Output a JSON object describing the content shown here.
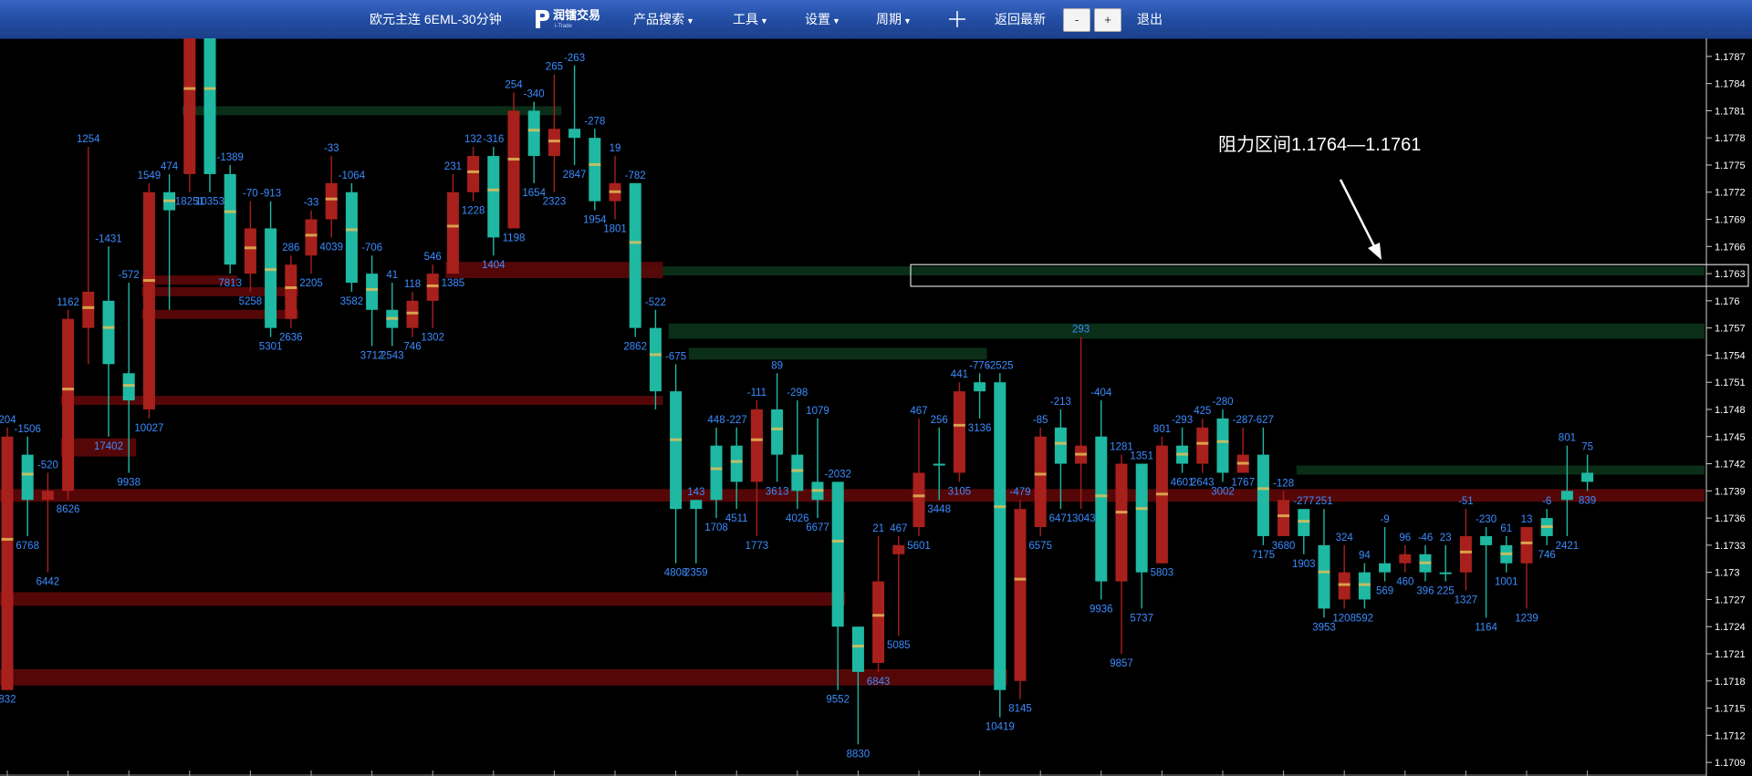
{
  "toolbar": {
    "title": "欧元主连 6EML-30分钟",
    "logo_text": "润镭交易",
    "logo_sub": "i-Trade",
    "product_search": "产品搜索",
    "tools": "工具",
    "settings": "设置",
    "period": "周期",
    "back_latest": "返回最新",
    "minus": "-",
    "plus": "+",
    "exit": "退出"
  },
  "annotation": {
    "text": "阻力区间1.1764—1.1761"
  },
  "colors": {
    "up": "#1fb8a2",
    "down": "#a8201c",
    "label": "#3b8cff",
    "axis_text": "#ffffff"
  },
  "chart_data": {
    "type": "candlestick",
    "interval": "30分钟",
    "ylim": [
      1.17075,
      1.1789
    ],
    "y_ticks": [
      "1.1787",
      "1.1784",
      "1.1781",
      "1.1778",
      "1.1775",
      "1.1772",
      "1.1769",
      "1.1766",
      "1.1763",
      "1.176",
      "1.1757",
      "1.1754",
      "1.1751",
      "1.1748",
      "1.1745",
      "1.1742",
      "1.1739",
      "1.1736",
      "1.1733",
      "1.173",
      "1.1727",
      "1.1724",
      "1.1721",
      "1.1718",
      "1.1715",
      "1.1712",
      "1.1709"
    ],
    "candles": [
      {
        "o": 1.1745,
        "h": 1.1746,
        "l": 1.1717,
        "c": 1.1717,
        "top": "204",
        "bot": "832"
      },
      {
        "o": 1.1738,
        "h": 1.1745,
        "l": 1.1734,
        "c": 1.1743,
        "top": "-1506",
        "bot": "6768"
      },
      {
        "o": 1.1739,
        "h": 1.1741,
        "l": 1.173,
        "c": 1.1738,
        "top": "-520",
        "bot": "6442"
      },
      {
        "o": 1.1758,
        "h": 1.1759,
        "l": 1.1738,
        "c": 1.1739,
        "top": "1162",
        "bot": "8626"
      },
      {
        "o": 1.1761,
        "h": 1.1777,
        "l": 1.1753,
        "c": 1.1757,
        "top": "1254",
        "bot": ""
      },
      {
        "o": 1.1753,
        "h": 1.1766,
        "l": 1.1745,
        "c": 1.176,
        "top": "-1431",
        "bot": "17402"
      },
      {
        "o": 1.1749,
        "h": 1.1762,
        "l": 1.1741,
        "c": 1.1752,
        "top": "-572",
        "bot": "9938"
      },
      {
        "o": 1.1772,
        "h": 1.1773,
        "l": 1.1747,
        "c": 1.1748,
        "top": "1549",
        "bot": "10027"
      },
      {
        "o": 1.177,
        "h": 1.1774,
        "l": 1.1759,
        "c": 1.1772,
        "top": "474",
        "bot": ""
      },
      {
        "o": 1.179,
        "h": 1.1792,
        "l": 1.1772,
        "c": 1.1774,
        "top": "",
        "bot": "18251"
      },
      {
        "o": 1.1774,
        "h": 1.1792,
        "l": 1.1772,
        "c": 1.179,
        "top": "",
        "bot": "10353"
      },
      {
        "o": 1.1764,
        "h": 1.1775,
        "l": 1.1763,
        "c": 1.1774,
        "top": "-1389",
        "bot": "7813"
      },
      {
        "o": 1.1768,
        "h": 1.1771,
        "l": 1.1761,
        "c": 1.1763,
        "top": "-70",
        "bot": "5258"
      },
      {
        "o": 1.1757,
        "h": 1.1771,
        "l": 1.1756,
        "c": 1.1768,
        "top": "-913",
        "bot": "5301"
      },
      {
        "o": 1.1764,
        "h": 1.1765,
        "l": 1.1757,
        "c": 1.1758,
        "top": "286",
        "bot": "2636"
      },
      {
        "o": 1.1769,
        "h": 1.177,
        "l": 1.1763,
        "c": 1.1765,
        "top": "-33",
        "bot": "2205"
      },
      {
        "o": 1.1773,
        "h": 1.1776,
        "l": 1.1767,
        "c": 1.1769,
        "top": "-33",
        "bot": "4039"
      },
      {
        "o": 1.1762,
        "h": 1.1773,
        "l": 1.1761,
        "c": 1.1772,
        "top": "-1064",
        "bot": "3582"
      },
      {
        "o": 1.1759,
        "h": 1.1765,
        "l": 1.1755,
        "c": 1.1763,
        "top": "-706",
        "bot": "3712"
      },
      {
        "o": 1.1757,
        "h": 1.1762,
        "l": 1.1755,
        "c": 1.1759,
        "top": "41",
        "bot": "2543"
      },
      {
        "o": 1.176,
        "h": 1.1761,
        "l": 1.1756,
        "c": 1.1757,
        "top": "118",
        "bot": "746"
      },
      {
        "o": 1.1763,
        "h": 1.1764,
        "l": 1.1757,
        "c": 1.176,
        "top": "546",
        "bot": "1302"
      },
      {
        "o": 1.1772,
        "h": 1.1774,
        "l": 1.1763,
        "c": 1.1763,
        "top": "231",
        "bot": "1385"
      },
      {
        "o": 1.1776,
        "h": 1.1777,
        "l": 1.1771,
        "c": 1.1772,
        "top": "132",
        "bot": "1228"
      },
      {
        "o": 1.1767,
        "h": 1.1777,
        "l": 1.1765,
        "c": 1.1776,
        "top": "-316",
        "bot": "1404"
      },
      {
        "o": 1.1781,
        "h": 1.1783,
        "l": 1.1768,
        "c": 1.1768,
        "top": "254",
        "bot": "1198"
      },
      {
        "o": 1.1776,
        "h": 1.1782,
        "l": 1.1773,
        "c": 1.1781,
        "top": "-340",
        "bot": "1654"
      },
      {
        "o": 1.1779,
        "h": 1.1785,
        "l": 1.1772,
        "c": 1.1776,
        "top": "265",
        "bot": "2323"
      },
      {
        "o": 1.1778,
        "h": 1.1786,
        "l": 1.1775,
        "c": 1.1779,
        "top": "-263",
        "bot": "2847"
      },
      {
        "o": 1.1771,
        "h": 1.1779,
        "l": 1.177,
        "c": 1.1778,
        "top": "-278",
        "bot": "1954"
      },
      {
        "o": 1.1773,
        "h": 1.1776,
        "l": 1.1769,
        "c": 1.1771,
        "top": "19",
        "bot": "1801"
      },
      {
        "o": 1.1757,
        "h": 1.1773,
        "l": 1.1756,
        "c": 1.1773,
        "top": "-782",
        "bot": "2862"
      },
      {
        "o": 1.175,
        "h": 1.1759,
        "l": 1.1748,
        "c": 1.1757,
        "top": "-522",
        "bot": ""
      },
      {
        "o": 1.1737,
        "h": 1.1753,
        "l": 1.1731,
        "c": 1.175,
        "top": "-675",
        "bot": "4808"
      },
      {
        "o": 1.1737,
        "h": 1.1738,
        "l": 1.1731,
        "c": 1.1738,
        "top": "143",
        "bot": "2359"
      },
      {
        "o": 1.1738,
        "h": 1.1746,
        "l": 1.1736,
        "c": 1.1744,
        "top": "448",
        "bot": "1708"
      },
      {
        "o": 1.174,
        "h": 1.1746,
        "l": 1.1737,
        "c": 1.1744,
        "top": "-227",
        "bot": "4511"
      },
      {
        "o": 1.1748,
        "h": 1.1749,
        "l": 1.1734,
        "c": 1.174,
        "top": "-111",
        "bot": "1773"
      },
      {
        "o": 1.1743,
        "h": 1.1752,
        "l": 1.174,
        "c": 1.1748,
        "top": "89",
        "bot": "3613"
      },
      {
        "o": 1.1739,
        "h": 1.1749,
        "l": 1.1737,
        "c": 1.1743,
        "top": "-298",
        "bot": "4026"
      },
      {
        "o": 1.1738,
        "h": 1.1747,
        "l": 1.1736,
        "c": 1.174,
        "top": "1079",
        "bot": "6677"
      },
      {
        "o": 1.1724,
        "h": 1.174,
        "l": 1.1717,
        "c": 1.174,
        "top": "-2032",
        "bot": "9552"
      },
      {
        "o": 1.1719,
        "h": 1.1724,
        "l": 1.1711,
        "c": 1.1724,
        "top": "",
        "bot": "8830"
      },
      {
        "o": 1.1729,
        "h": 1.1734,
        "l": 1.1719,
        "c": 1.172,
        "top": "21",
        "bot": "6843"
      },
      {
        "o": 1.1733,
        "h": 1.1734,
        "l": 1.1723,
        "c": 1.1732,
        "top": "467",
        "bot": "5085"
      },
      {
        "o": 1.1741,
        "h": 1.1747,
        "l": 1.1734,
        "c": 1.1735,
        "top": "467",
        "bot": "5601"
      },
      {
        "o": 1.1742,
        "h": 1.1746,
        "l": 1.1738,
        "c": 1.1742,
        "top": "256",
        "bot": "3448"
      },
      {
        "o": 1.175,
        "h": 1.1751,
        "l": 1.174,
        "c": 1.1741,
        "top": "441",
        "bot": "3105"
      },
      {
        "o": 1.175,
        "h": 1.1752,
        "l": 1.1747,
        "c": 1.1751,
        "top": "-776",
        "bot": "3136"
      },
      {
        "o": 1.1717,
        "h": 1.1752,
        "l": 1.1714,
        "c": 1.1751,
        "top": "-2525",
        "bot": "10419"
      },
      {
        "o": 1.1737,
        "h": 1.1738,
        "l": 1.1716,
        "c": 1.1718,
        "top": "-479",
        "bot": "8145"
      },
      {
        "o": 1.1745,
        "h": 1.1746,
        "l": 1.1734,
        "c": 1.1735,
        "top": "-85",
        "bot": "6575"
      },
      {
        "o": 1.1742,
        "h": 1.1748,
        "l": 1.1737,
        "c": 1.1746,
        "top": "-213",
        "bot": "6471"
      },
      {
        "o": 1.1744,
        "h": 1.1756,
        "l": 1.1737,
        "c": 1.1742,
        "top": "293",
        "bot": "13043"
      },
      {
        "o": 1.1729,
        "h": 1.1749,
        "l": 1.1727,
        "c": 1.1745,
        "top": "-404",
        "bot": "9936"
      },
      {
        "o": 1.1742,
        "h": 1.1743,
        "l": 1.1721,
        "c": 1.1729,
        "top": "1281",
        "bot": "9857"
      },
      {
        "o": 1.173,
        "h": 1.1742,
        "l": 1.1726,
        "c": 1.1742,
        "top": "1351",
        "bot": "5737"
      },
      {
        "o": 1.1744,
        "h": 1.1745,
        "l": 1.1731,
        "c": 1.1731,
        "top": "801",
        "bot": "5803"
      },
      {
        "o": 1.1742,
        "h": 1.1746,
        "l": 1.1741,
        "c": 1.1744,
        "top": "-293",
        "bot": "4601"
      },
      {
        "o": 1.1746,
        "h": 1.1747,
        "l": 1.1741,
        "c": 1.1742,
        "top": "425",
        "bot": "2643"
      },
      {
        "o": 1.1741,
        "h": 1.1748,
        "l": 1.174,
        "c": 1.1747,
        "top": "-280",
        "bot": "3002"
      },
      {
        "o": 1.1743,
        "h": 1.1746,
        "l": 1.1741,
        "c": 1.1741,
        "top": "-287",
        "bot": "1767"
      },
      {
        "o": 1.1734,
        "h": 1.1746,
        "l": 1.1733,
        "c": 1.1743,
        "top": "-627",
        "bot": "7175"
      },
      {
        "o": 1.1738,
        "h": 1.1739,
        "l": 1.1734,
        "c": 1.1734,
        "top": "-128",
        "bot": "3680"
      },
      {
        "o": 1.1734,
        "h": 1.1737,
        "l": 1.1732,
        "c": 1.1737,
        "top": "-277",
        "bot": "1903"
      },
      {
        "o": 1.1726,
        "h": 1.1737,
        "l": 1.1725,
        "c": 1.1733,
        "top": "251",
        "bot": "3953"
      },
      {
        "o": 1.173,
        "h": 1.1733,
        "l": 1.1726,
        "c": 1.1727,
        "top": "324",
        "bot": "1208"
      },
      {
        "o": 1.1727,
        "h": 1.1731,
        "l": 1.1726,
        "c": 1.173,
        "top": "94",
        "bot": "592"
      },
      {
        "o": 1.173,
        "h": 1.1735,
        "l": 1.1729,
        "c": 1.1731,
        "top": "-9",
        "bot": "569"
      },
      {
        "o": 1.1732,
        "h": 1.1733,
        "l": 1.173,
        "c": 1.1731,
        "top": "96",
        "bot": "460"
      },
      {
        "o": 1.173,
        "h": 1.1733,
        "l": 1.1729,
        "c": 1.1732,
        "top": "-46",
        "bot": "396"
      },
      {
        "o": 1.173,
        "h": 1.1733,
        "l": 1.1729,
        "c": 1.173,
        "top": "23",
        "bot": "225"
      },
      {
        "o": 1.1734,
        "h": 1.1737,
        "l": 1.1728,
        "c": 1.173,
        "top": "-51",
        "bot": "1327"
      },
      {
        "o": 1.1733,
        "h": 1.1735,
        "l": 1.1725,
        "c": 1.1734,
        "top": "-230",
        "bot": "1164"
      },
      {
        "o": 1.1731,
        "h": 1.1734,
        "l": 1.173,
        "c": 1.1733,
        "top": "61",
        "bot": "1001"
      },
      {
        "o": 1.1735,
        "h": 1.1735,
        "l": 1.1726,
        "c": 1.1731,
        "top": "13",
        "bot": "1239"
      },
      {
        "o": 1.1734,
        "h": 1.1737,
        "l": 1.1733,
        "c": 1.1736,
        "top": "-6",
        "bot": "746"
      },
      {
        "o": 1.1738,
        "h": 1.1744,
        "l": 1.1734,
        "c": 1.1739,
        "top": "801",
        "bot": "2421"
      },
      {
        "o": 1.174,
        "h": 1.1743,
        "l": 1.1739,
        "c": 1.1741,
        "top": "75",
        "bot": "839"
      }
    ],
    "zones": [
      {
        "kind": "support",
        "y0": 1.17805,
        "y1": 1.17815,
        "from": 9,
        "to": 27
      },
      {
        "kind": "support",
        "y0": 1.17628,
        "y1": 1.17638,
        "from": 31,
        "to": 80
      },
      {
        "kind": "support",
        "y0": 1.17558,
        "y1": 1.17575,
        "from": 33,
        "to": 80
      },
      {
        "kind": "support",
        "y0": 1.17535,
        "y1": 1.17548,
        "from": 34,
        "to": 48
      },
      {
        "kind": "support",
        "y0": 1.17408,
        "y1": 1.17418,
        "from": 64,
        "to": 80
      },
      {
        "kind": "resistance",
        "y0": 1.17625,
        "y1": 1.17643,
        "from": 22,
        "to": 32
      },
      {
        "kind": "resistance",
        "y0": 1.17618,
        "y1": 1.17628,
        "from": 7,
        "to": 11
      },
      {
        "kind": "resistance",
        "y0": 1.17605,
        "y1": 1.17615,
        "from": 7,
        "to": 14
      },
      {
        "kind": "resistance",
        "y0": 1.1758,
        "y1": 1.1759,
        "from": 7,
        "to": 14
      },
      {
        "kind": "resistance",
        "y0": 1.17485,
        "y1": 1.17495,
        "from": 3,
        "to": 32
      },
      {
        "kind": "resistance",
        "y0": 1.17428,
        "y1": 1.17448,
        "from": 3,
        "to": 6
      },
      {
        "kind": "resistance",
        "y0": 1.17378,
        "y1": 1.17392,
        "from": 0,
        "to": 80
      },
      {
        "kind": "resistance",
        "y0": 1.17263,
        "y1": 1.17278,
        "from": 0,
        "to": 41
      },
      {
        "kind": "resistance",
        "y0": 1.17175,
        "y1": 1.17193,
        "from": 0,
        "to": 49
      }
    ],
    "resistance_box": [
      1.17616,
      1.1764
    ],
    "annotation": "阻力区间1.1764—1.1761"
  }
}
